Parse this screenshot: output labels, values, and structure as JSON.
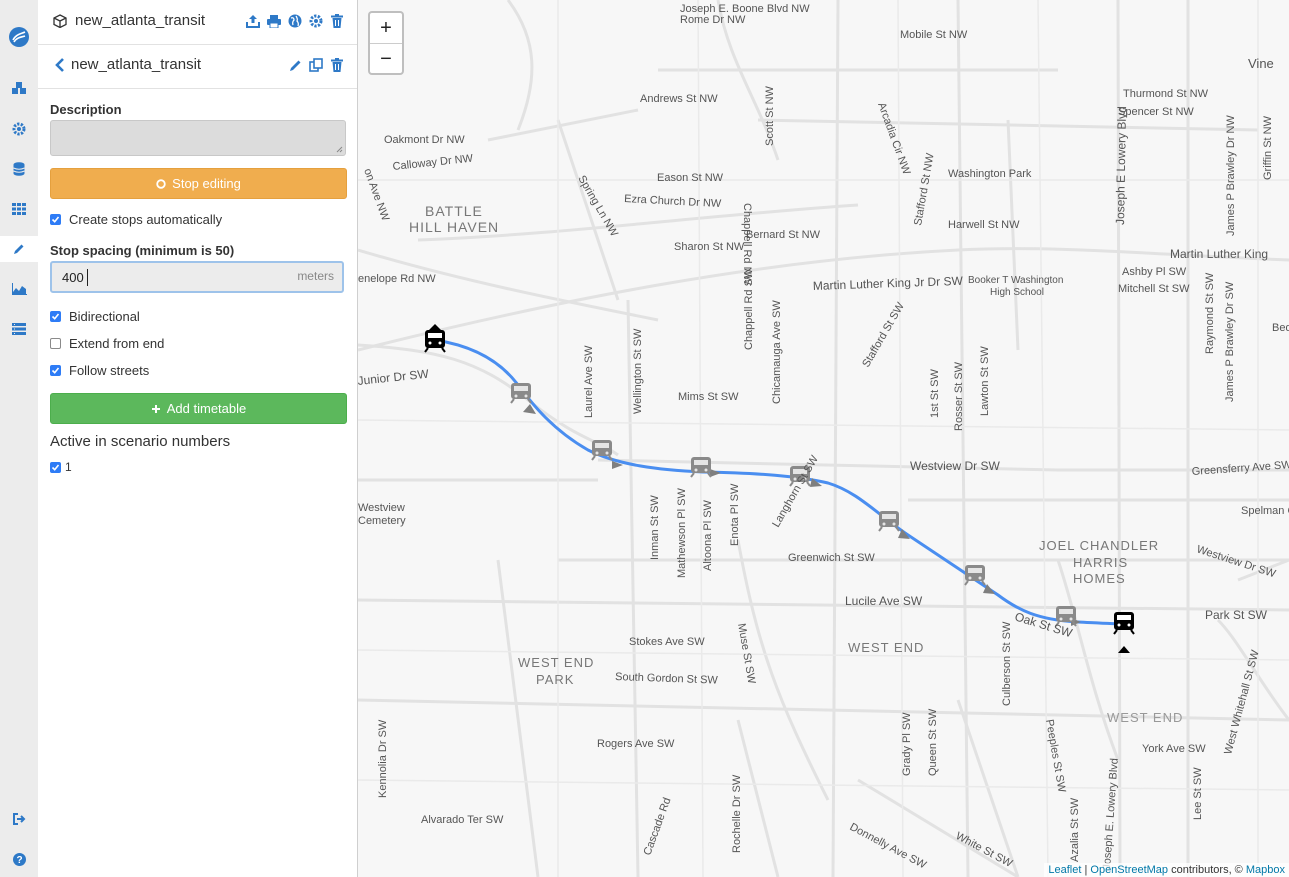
{
  "sidebar": {
    "icons": [
      "logo-icon",
      "modifications-icon",
      "settings-icon",
      "database-icon",
      "grid-icon",
      "edit-icon",
      "analysis-icon",
      "regional-icon",
      "logout-icon",
      "help-icon"
    ]
  },
  "project": {
    "name": "new_atlanta_transit"
  },
  "modification": {
    "name": "new_atlanta_transit",
    "description_label": "Description",
    "description_value": "",
    "stop_editing_label": "Stop editing",
    "create_stops_label": "Create stops automatically",
    "create_stops_checked": true,
    "stop_spacing_label": "Stop spacing (minimum is 50)",
    "stop_spacing_value": "400",
    "stop_spacing_unit": "meters",
    "bidirectional_label": "Bidirectional",
    "bidirectional_checked": true,
    "extend_label": "Extend from end",
    "extend_checked": false,
    "follow_label": "Follow streets",
    "follow_checked": true,
    "add_timetable_label": "Add timetable",
    "scenarios_label": "Active in scenario numbers",
    "scenarios": [
      "1"
    ]
  },
  "map": {
    "zoom_in": "+",
    "zoom_out": "−",
    "route_color": "#4a8ef0",
    "labels": {
      "l1": "Joseph E. Boone Blvd NW",
      "l2": "Rome Dr NW",
      "l3": "Mobile St NW",
      "l4": "Vine",
      "l5": "Andrews St NW",
      "l6": "Oakmont Dr NW",
      "l7": "Calloway Dr NW",
      "l8": "Eason St NW",
      "l9": "Ezra Church Dr NW",
      "l10": "BATTLE",
      "l11": "HILL HAVEN",
      "l12": "Sharon St NW",
      "l13": "Bernard St NW",
      "l14": "Washington Park",
      "l15": "Harwell St NW",
      "l16": "Thurmond St NW",
      "l17": "Spencer St NW",
      "l18": "Martin Luther King",
      "l19": "Martin Luther King Jr Dr SW",
      "l20": "Booker T Washington",
      "l21": "High School",
      "l22": "Ashby Pl SW",
      "l23": "Mitchell St SW",
      "l24": "Mims St SW",
      "l25": "Westview Dr SW",
      "l26": "Greensferry Ave SW",
      "l27": "Westview",
      "l28": "Cemetery",
      "l29": "Spelman Coll",
      "l30": "JOEL CHANDLER",
      "l31": "HARRIS",
      "l32": "HOMES",
      "l33": "Greenwich St SW",
      "l34": "Lucile Ave SW",
      "l35": "Park St SW",
      "l36": "Oak St SW",
      "l37": "WEST END",
      "l38": "PARK",
      "l39": "WEST END",
      "l40": "Stokes Ave SW",
      "l41": "South Gordon St SW",
      "l42": "WEST END",
      "l43": "Rogers Ave SW",
      "l44": "York Ave SW",
      "l45": "Alvarado Ter SW",
      "l46": "Donnelly Ave SW",
      "l47": "White St SW",
      "l48": "Westview Dr SW",
      "l49": "Junior Dr SW",
      "l50": "enelope Rd NW",
      "l51": "on Ave NW",
      "l52": "Bed",
      "l53": "Laurel Ave SW",
      "l54": "Wellington St SW",
      "l55": "Chicamauga Ave SW",
      "l56": "Chappell Rd SW",
      "l57": "Inman St SW",
      "l58": "Mathewson Pl SW",
      "l59": "Altoona Pl SW",
      "l60": "Enota Pl SW",
      "l61": "Langhorn St SW",
      "l62": "Stafford St SW",
      "l63": "1st St SW",
      "l64": "Rosser St SW",
      "l65": "Lawton St SW",
      "l66": "Culberson St SW",
      "l67": "Peeples St SW",
      "l68": "Muse St SW",
      "l69": "Grady Pl SW",
      "l70": "Queen St SW",
      "l71": "Kennolia Dr SW",
      "l72": "Cascade Rd",
      "l73": "Rochelle Dr SW",
      "l74": "Azalia St SW",
      "l75": "Joseph E Lowery Blvd",
      "l76": "Joseph E. Lowery Blvd",
      "l77": "Lee St SW",
      "l78": "West Whitehall St SW",
      "l79": "Raymond St SW",
      "l80": "James P Brawley Dr SW",
      "l81": "Griffin St NW",
      "l82": "James P Brawley Dr NW",
      "l83": "Chappell Rd NW",
      "l84": "Scott St NW",
      "l85": "Spring Ln NW",
      "l86": "Arcadia Cir NW",
      "l87": "Stafford St NW"
    },
    "attribution": {
      "leaflet": "Leaflet",
      "osm": "OpenStreetMap",
      "mid": " contributors, © ",
      "mapbox": "Mapbox"
    }
  }
}
